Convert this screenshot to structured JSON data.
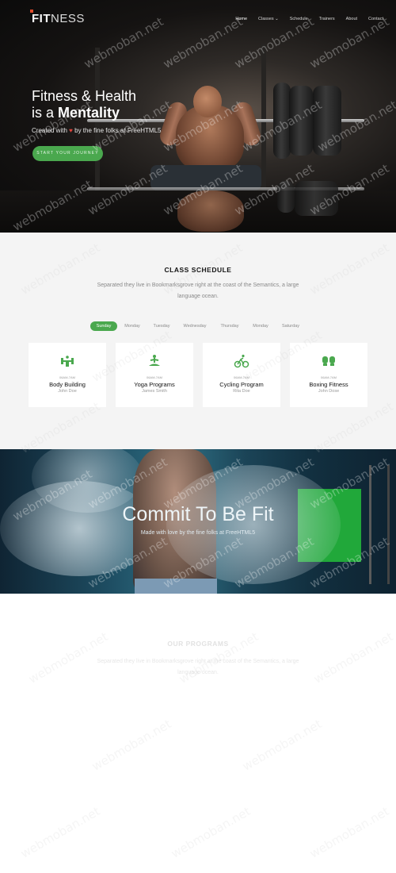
{
  "header": {
    "logo_bold": "FIT",
    "logo_thin": "NESS",
    "menu": [
      "Home",
      "Classes ⌄",
      "Schedule",
      "Trainers",
      "About",
      "Contact"
    ]
  },
  "hero": {
    "title_line1": "Fitness & Health",
    "title_line2_prefix": "is a ",
    "title_line2_strong": "Mentality",
    "subtitle_prefix": "Created with ",
    "subtitle_suffix": " by the fine folks at FreeHTML5",
    "button_label": "START YOUR JOURNEY"
  },
  "schedule": {
    "title": "CLASS SCHEDULE",
    "description": "Separated they live in Bookmarksgrove right at the coast of the Semantics, a large language ocean.",
    "days": [
      "Sunday",
      "Monday",
      "Tuesday",
      "Wednesday",
      "Thursday",
      "Monday",
      "Saturday"
    ],
    "active_day": "Sunday",
    "classes": [
      {
        "time": "06AM-7AM",
        "name": "Body Building",
        "trainer": "John Doe",
        "icon": "dumbbell-icon"
      },
      {
        "time": "06AM-7AM",
        "name": "Yoga Programs",
        "trainer": "James Smith",
        "icon": "yoga-icon"
      },
      {
        "time": "06AM-7AM",
        "name": "Cycling Program",
        "trainer": "Rita Doe",
        "icon": "cycling-icon"
      },
      {
        "time": "06AM-7AM",
        "name": "Boxing Fitness",
        "trainer": "John Dose",
        "icon": "boxing-glove-icon"
      }
    ]
  },
  "commit": {
    "title": "Commit To Be Fit",
    "subtitle": "Made with love by the fine folks at FreeHTML5"
  },
  "programs": {
    "title": "OUR PROGRAMS",
    "description": "Separated they live in Bookmarksgrove right at the coast of the Semantics, a large language ocean."
  },
  "watermark": "webmoban.net",
  "colors": {
    "accent": "#4aa84e",
    "heart": "#e0443c"
  }
}
